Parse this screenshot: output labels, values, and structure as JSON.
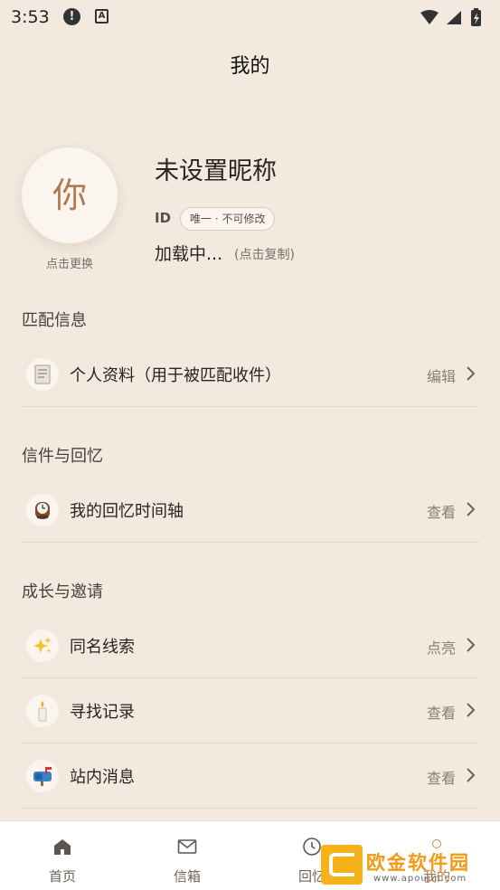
{
  "status_bar": {
    "time": "3:53"
  },
  "header": {
    "title": "我的"
  },
  "profile": {
    "avatar_char": "你",
    "avatar_hint": "点击更换",
    "nickname": "未设置昵称",
    "id_label": "ID",
    "id_badge": "唯一 · 不可修改",
    "id_value": "加载中...",
    "copy_hint": "(点击复制)"
  },
  "sections": [
    {
      "title": "匹配信息",
      "rows": [
        {
          "label": "个人资料（用于被匹配收件）",
          "action": "编辑",
          "icon": "document-icon"
        }
      ]
    },
    {
      "title": "信件与回忆",
      "rows": [
        {
          "label": "我的回忆时间轴",
          "action": "查看",
          "icon": "clock-icon"
        }
      ]
    },
    {
      "title": "成长与邀请",
      "rows": [
        {
          "label": "同名线索",
          "action": "点亮",
          "icon": "sparkles-icon"
        },
        {
          "label": "寻找记录",
          "action": "查看",
          "icon": "candle-icon"
        },
        {
          "label": "站内消息",
          "action": "查看",
          "icon": "mailbox-icon"
        }
      ]
    }
  ],
  "bottom_nav": [
    {
      "label": "首页",
      "icon": "home-icon"
    },
    {
      "label": "信箱",
      "icon": "mail-icon"
    },
    {
      "label": "回忆",
      "icon": "clock-icon"
    },
    {
      "label": "我的",
      "icon": "profile-icon",
      "active": true
    }
  ],
  "watermark": {
    "text": "欧金软件园",
    "url": "www.apoujin.com"
  },
  "colors": {
    "background": "#f3e9df",
    "accent": "#b07a52",
    "nav_bg": "#ffffff"
  }
}
